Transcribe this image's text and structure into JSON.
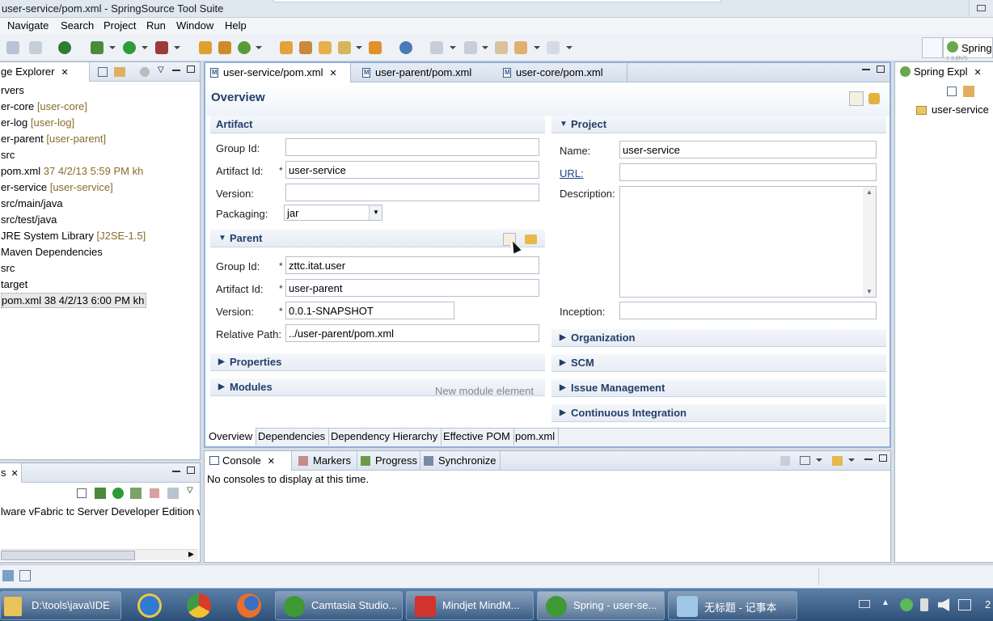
{
  "window": {
    "title": "user-service/pom.xml - SpringSource Tool Suite"
  },
  "menu": [
    "Navigate",
    "Search",
    "Project",
    "Run",
    "Window",
    "Help"
  ],
  "perspective": {
    "label": "Spring",
    "tiny": "1 3.8K/S"
  },
  "left_panel": {
    "title": "ge Explorer",
    "items": [
      {
        "text": "rvers",
        "dec": ""
      },
      {
        "text": "er-core",
        "dec": "[user-core]"
      },
      {
        "text": "er-log",
        "dec": "[user-log]"
      },
      {
        "text": "er-parent",
        "dec": "[user-parent]"
      },
      {
        "text": "src",
        "dec": ""
      },
      {
        "text": "pom.xml",
        "dec": "37  4/2/13 5:59 PM   kh"
      },
      {
        "text": "er-service",
        "dec": "[user-service]"
      },
      {
        "text": "src/main/java",
        "dec": ""
      },
      {
        "text": "src/test/java",
        "dec": ""
      },
      {
        "text": "JRE System Library",
        "dec": "[J2SE-1.5]"
      },
      {
        "text": "Maven Dependencies",
        "dec": ""
      },
      {
        "text": "src",
        "dec": ""
      },
      {
        "text": "target",
        "dec": ""
      },
      {
        "text": "pom.xml 38  4/2/13 6:00 PM   kh",
        "dec": ""
      }
    ]
  },
  "servers_panel": {
    "title": "s",
    "item": "lware vFabric tc Server Developer Edition v"
  },
  "editor": {
    "tabs": [
      "user-service/pom.xml",
      "user-parent/pom.xml",
      "user-core/pom.xml"
    ],
    "heading": "Overview",
    "artifact": {
      "title": "Artifact",
      "group_id_label": "Group Id:",
      "group_id": "",
      "artifact_id_label": "Artifact Id:",
      "artifact_id": "user-service",
      "version_label": "Version:",
      "version": "",
      "packaging_label": "Packaging:",
      "packaging": "jar"
    },
    "parent": {
      "title": "Parent",
      "group_id_label": "Group Id:",
      "group_id": "zttc.itat.user",
      "artifact_id_label": "Artifact Id:",
      "artifact_id": "user-parent",
      "version_label": "Version:",
      "version": "0.0.1-SNAPSHOT",
      "relpath_label": "Relative Path:",
      "relpath": "../user-parent/pom.xml"
    },
    "properties_title": "Properties",
    "modules_title": "Modules",
    "modules_hint": "New module element",
    "project": {
      "title": "Project",
      "name_label": "Name:",
      "name": "user-service",
      "url_label": "URL:",
      "url": "",
      "description_label": "Description:",
      "description": "",
      "inception_label": "Inception:",
      "inception": ""
    },
    "collapsed": [
      "Organization",
      "SCM",
      "Issue Management",
      "Continuous Integration"
    ],
    "bottom_tabs": [
      "Overview",
      "Dependencies",
      "Dependency Hierarchy",
      "Effective POM",
      "pom.xml"
    ]
  },
  "console": {
    "tabs": [
      "Console",
      "Markers",
      "Progress",
      "Synchronize"
    ],
    "message": "No consoles to display at this time."
  },
  "right_panel": {
    "title": "Spring Expl",
    "item": "user-service"
  },
  "taskbar": {
    "items": [
      "D:\\tools\\java\\IDE",
      "Camtasia Studio...",
      "Mindjet MindM...",
      "Spring - user-se...",
      "无标题 - 记事本"
    ],
    "clock": "2"
  }
}
